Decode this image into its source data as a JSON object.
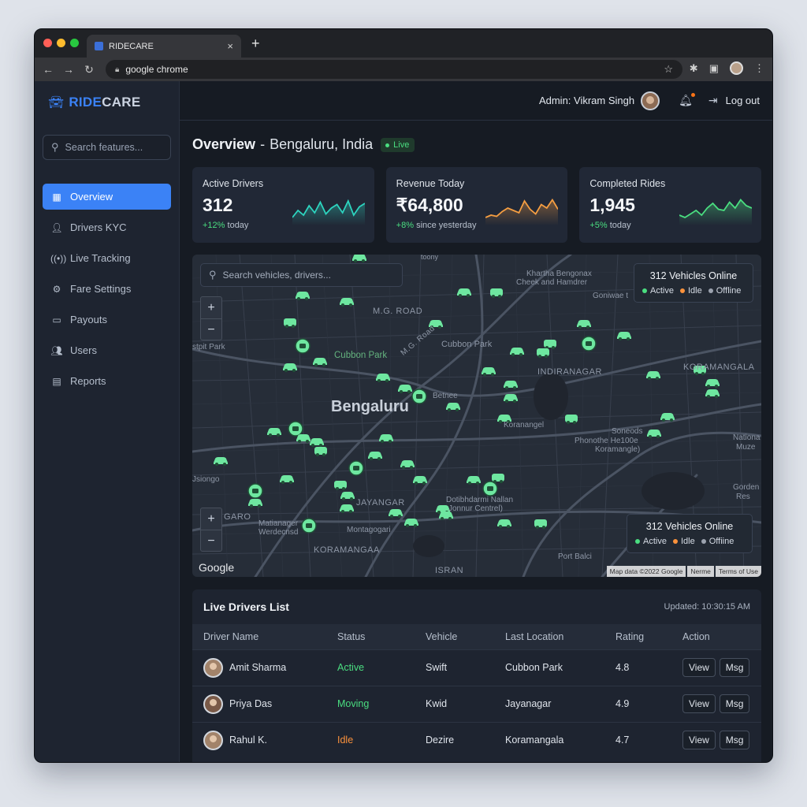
{
  "browser": {
    "tab_title": "RIDECARE",
    "url": "google chrome"
  },
  "brand": {
    "name_accent": "RIDE",
    "name_rest": "CARE"
  },
  "sidebar": {
    "search_placeholder": "Search features...",
    "items": [
      {
        "label": "Overview",
        "icon": "grid-icon",
        "active": true
      },
      {
        "label": "Drivers KYC",
        "icon": "user-check-icon"
      },
      {
        "label": "Live Tracking",
        "icon": "radio-signal-icon"
      },
      {
        "label": "Fare Settings",
        "icon": "gear-icon"
      },
      {
        "label": "Payouts",
        "icon": "wallet-icon"
      },
      {
        "label": "Users",
        "icon": "users-icon"
      },
      {
        "label": "Reports",
        "icon": "report-icon"
      }
    ]
  },
  "header": {
    "admin_label": "Admin: Vikram Singh",
    "logout_label": "Log out"
  },
  "page": {
    "title": "Overview",
    "separator": "-",
    "city": "Bengaluru, India",
    "badge": "Live"
  },
  "stats": [
    {
      "label": "Active Drivers",
      "value": "312",
      "change": "+12%",
      "period": "today",
      "color": "#2dd4bf"
    },
    {
      "label": "Revenue Today",
      "value": "₹64,800",
      "change": "+8%",
      "period": "since yesterday",
      "color": "#f59e42"
    },
    {
      "label": "Completed Rides",
      "value": "1,945",
      "change": "+5%",
      "period": "today",
      "color": "#4ade80"
    }
  ],
  "map": {
    "search_placeholder": "Search vehicles, drivers...",
    "online_title": "312 Vehicles Online",
    "legend": {
      "active": "Active",
      "idle": "Idle",
      "offline": "Offline",
      "offline_alt": "Offiine"
    },
    "labels": {
      "city": "Bengaluru",
      "mg_road": "M.G. ROAD",
      "mg_road2": "M.G. Road",
      "cubbon_park": "Cubbon Park",
      "cubbon_park2": "Cubbon Park",
      "indiranagar": "INDIRANAGAR",
      "koramangala": "KORAMANGALA",
      "koramangala2": "KORAMANGAA",
      "koramangal": "Koranangel",
      "jayanagar": "JAYANGAR",
      "garo": "GARO",
      "khartha": "Khartha Bengonax",
      "check": "Cheek and Hamdrer",
      "goniwae": "Goniwae t",
      "stpit": "stpit Park",
      "soneods": "Soneods",
      "phonothe": "Phonothe He100e",
      "koramangle": "Koramangle)",
      "national": "Nationa",
      "muze": "Muze",
      "gorden": "Gorden",
      "res": "Res",
      "port_balci": "Port Balci",
      "israan": "ISRAN",
      "dotibhdarmi": "Dotibhdarmi Nallan",
      "jonnur": "Jonnur Centrel)",
      "montagogari": "Montagogari",
      "matianager": "Matianager",
      "werdecnsd": "Werdecnsd",
      "jsiongo": "Jsiongo",
      "betnee": "Betnee",
      "toony": "toony"
    },
    "google": "Google",
    "footer": [
      "Map data ©2022 Google",
      "Nerme",
      "Terms of Use"
    ]
  },
  "drivers": {
    "title": "Live Drivers List",
    "updated": "Updated: 10:30:15 AM",
    "columns": [
      "Driver Name",
      "Status",
      "Vehicle",
      "Last Location",
      "Rating",
      "Action"
    ],
    "rows": [
      {
        "name": "Amit Sharma",
        "status": "Active",
        "vehicle": "Swift",
        "location": "Cubbon Park",
        "rating": "4.8"
      },
      {
        "name": "Priya Das",
        "status": "Moving",
        "vehicle": "Kwid",
        "location": "Jayanagar",
        "rating": "4.9"
      },
      {
        "name": "Rahul K.",
        "status": "Idle",
        "vehicle": "Dezire",
        "location": "Koramangala",
        "rating": "4.7"
      }
    ],
    "view_label": "View",
    "msg_label": "Msg"
  }
}
